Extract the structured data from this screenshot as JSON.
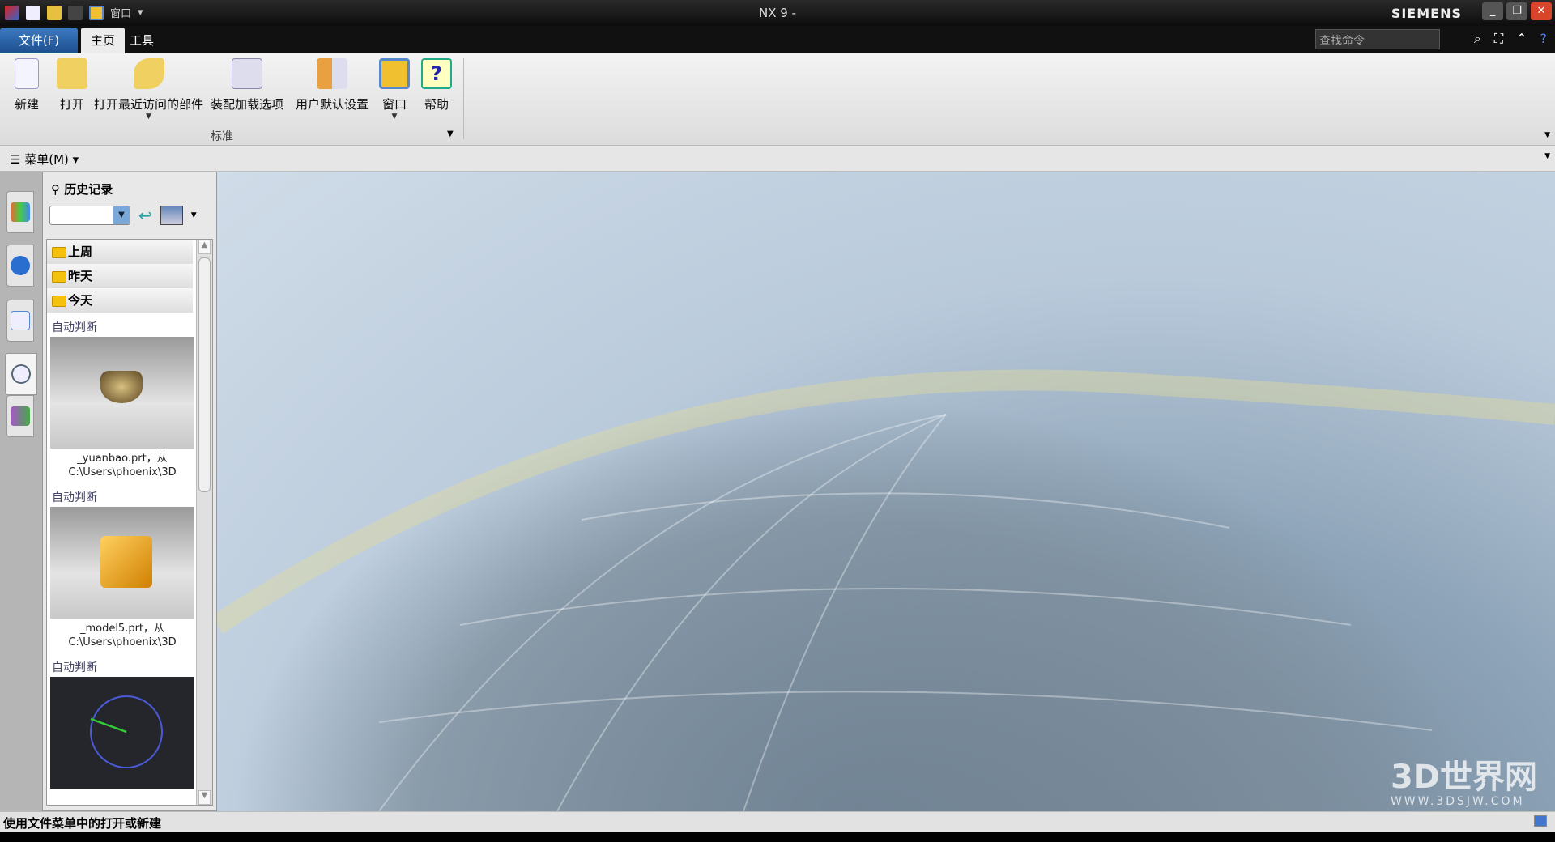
{
  "titlebar": {
    "title": "NX 9 -",
    "brand": "SIEMENS",
    "quick_window_label": "窗口"
  },
  "tabs": {
    "file": "文件(F)",
    "home": "主页",
    "tools": "工具"
  },
  "search": {
    "placeholder": "查找命令"
  },
  "ribbon": {
    "buttons": [
      {
        "label": "新建"
      },
      {
        "label": "打开"
      },
      {
        "label": "打开最近访问的部件"
      },
      {
        "label": "装配加载选项"
      },
      {
        "label": "用户默认设置"
      },
      {
        "label": "窗口"
      },
      {
        "label": "帮助"
      }
    ],
    "group_label": "标准"
  },
  "menubar": {
    "menu_label": "菜单(M)"
  },
  "history": {
    "title": "历史记录",
    "groups": [
      "上周",
      "昨天",
      "今天"
    ],
    "items": [
      {
        "type": "自动判断",
        "caption1": "_yuanbao.prt，从",
        "caption2": "C:\\Users\\phoenix\\3D"
      },
      {
        "type": "自动判断",
        "caption1": "_model5.prt，从",
        "caption2": "C:\\Users\\phoenix\\3D"
      },
      {
        "type": "自动判断"
      }
    ]
  },
  "status": {
    "text": "使用文件菜单中的打开或新建"
  },
  "watermark": {
    "text": "3D世界网",
    "url": "WWW.3DSJW.COM"
  }
}
